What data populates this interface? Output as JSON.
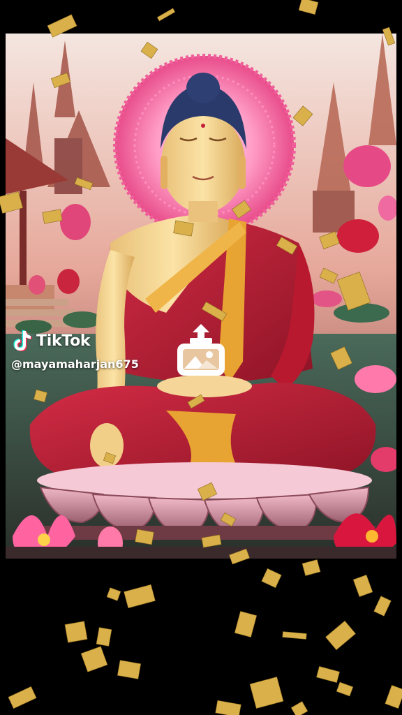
{
  "watermark": {
    "brand": "TikTok",
    "handle": "@mayamaharjan675",
    "logo_icon": "tiktok-note-icon"
  },
  "center_icon": "image-upload-icon",
  "scene": {
    "subject": "seated-buddha",
    "colors": {
      "robe": "#b51f34",
      "robe_trim": "#e8a432",
      "skin": "#f0cf8a",
      "hair": "#2a3a6b",
      "halo": "#ff7bb0",
      "lotus": "#ff5c95",
      "confetti": "#d9b04a"
    }
  }
}
